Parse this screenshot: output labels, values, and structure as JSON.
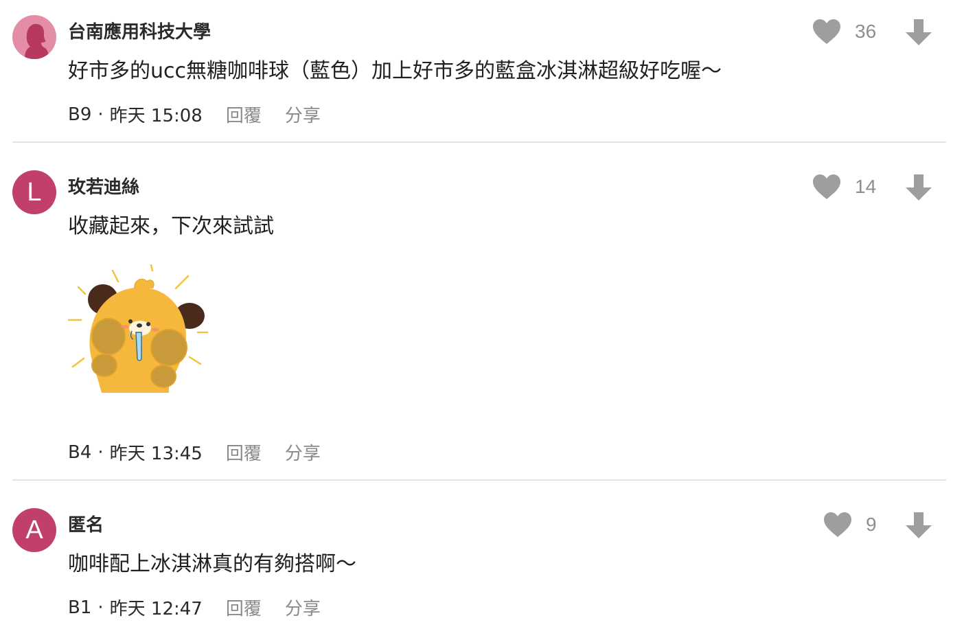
{
  "comments": [
    {
      "author": "台南應用科技大學",
      "avatar_letter": "",
      "avatar_color": "#e38ea6",
      "content": "好市多的ucc無糖咖啡球（藍色）加上好市多的藍盒冰淇淋超級好吃喔～",
      "floor": "B9",
      "time": "昨天 15:08",
      "likes": "36",
      "reply_label": "回覆",
      "share_label": "分享",
      "has_sticker": false
    },
    {
      "author": "玫若迪絲",
      "avatar_letter": "L",
      "avatar_color": "#c0406a",
      "content": "收藏起來，下次來試試",
      "floor": "B4",
      "time": "昨天 13:45",
      "likes": "14",
      "reply_label": "回覆",
      "share_label": "分享",
      "has_sticker": true
    },
    {
      "author": "匿名",
      "avatar_letter": "A",
      "avatar_color": "#c0406a",
      "content": "咖啡配上冰淇淋真的有夠搭啊～",
      "floor": "B1",
      "time": "昨天 12:47",
      "likes": "9",
      "reply_label": "回覆",
      "share_label": "分享",
      "has_sticker": false
    }
  ],
  "icons": {
    "like": "heart-icon",
    "dislike": "arrow-down-icon",
    "avatar_default": "female-silhouette-icon",
    "sticker": "crying-bear-sticker"
  },
  "colors": {
    "icon_gray": "#9e9e9e",
    "divider": "#e4e4e4",
    "action_gray": "#8a8a8a"
  }
}
